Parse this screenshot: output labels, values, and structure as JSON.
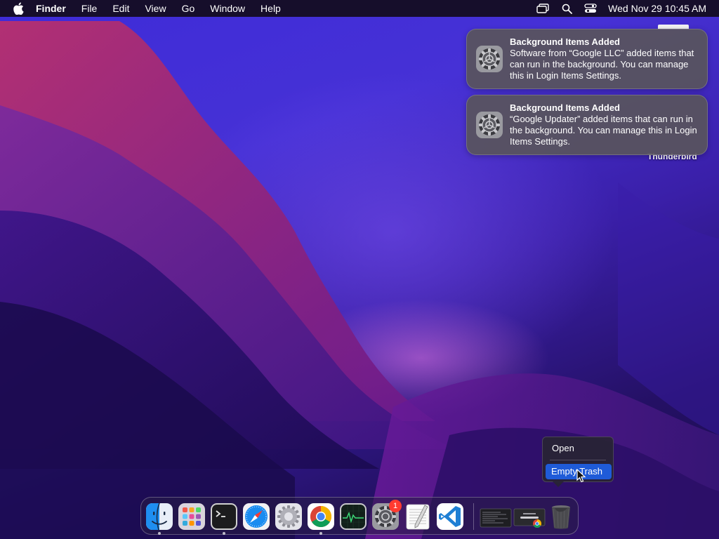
{
  "menubar": {
    "app_name": "Finder",
    "items": [
      "File",
      "Edit",
      "View",
      "Go",
      "Window",
      "Help"
    ],
    "clock": "Wed Nov 29  10:45 AM",
    "status_icons": [
      "screen-mirroring-icon",
      "spotlight-search-icon",
      "control-center-icon"
    ]
  },
  "notifications": [
    {
      "title": "Background Items Added",
      "body": "Software from “Google LLC” added items that can run in the background. You can manage this in Login Items Settings.",
      "icon": "system-settings-gear-icon"
    },
    {
      "title": "Background Items Added",
      "body": "“Google Updater” added items that can run in the background. You can manage this in Login Items Settings.",
      "icon": "system-settings-gear-icon"
    }
  ],
  "desktop": {
    "item_label": "Thunderbird"
  },
  "context_menu": {
    "open_label": "Open",
    "empty_trash_label": "Empty Trash",
    "highlighted": "Empty Trash"
  },
  "dock": {
    "apps": [
      "finder-icon",
      "launchpad-icon",
      "terminal-icon",
      "safari-icon",
      "system-preferences-icon",
      "chrome-icon",
      "activity-monitor-icon",
      "system-settings-icon",
      "textedit-icon",
      "vscode-icon"
    ],
    "minimized": [
      "terminal-window-thumbnail",
      "chrome-window-thumbnail"
    ],
    "trash": "trash-icon",
    "badge_count": "1"
  },
  "colors": {
    "accent": "#1f5bd8",
    "badge": "#ff3b30",
    "menubar": "#120c1c"
  }
}
